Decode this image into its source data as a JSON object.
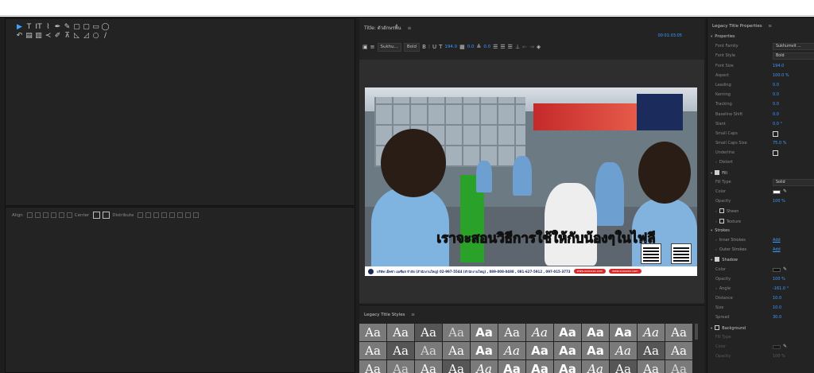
{
  "tools": [
    {
      "icon": "selection-tool-icon",
      "glyph": "▶",
      "selected": true
    },
    {
      "icon": "type-tool-icon",
      "glyph": "T"
    },
    {
      "icon": "vertical-type-tool-icon",
      "glyph": "IT"
    },
    {
      "icon": "path-type-tool-icon",
      "glyph": "⌇"
    },
    {
      "icon": "pen-tool-icon",
      "glyph": "✒"
    },
    {
      "icon": "add-anchor-point-tool-icon",
      "glyph": "✎"
    },
    {
      "icon": "rectangle-tool-icon",
      "glyph": "▢"
    },
    {
      "icon": "rounded-rectangle-tool-icon",
      "glyph": "▢"
    },
    {
      "icon": "clipped-corner-rectangle-tool-icon",
      "glyph": "▭"
    },
    {
      "icon": "ellipse-tool-icon",
      "glyph": "◯"
    },
    {
      "icon": "rotation-tool-icon",
      "glyph": "↶"
    },
    {
      "icon": "area-type-tool-icon",
      "glyph": "▤"
    },
    {
      "icon": "vertical-area-type-tool-icon",
      "glyph": "▥"
    },
    {
      "icon": "vertical-path-type-tool-icon",
      "glyph": "≺"
    },
    {
      "icon": "delete-anchor-point-tool-icon",
      "glyph": "✐"
    },
    {
      "icon": "convert-anchor-point-tool-icon",
      "glyph": "⊼"
    },
    {
      "icon": "wedge-tool-icon",
      "glyph": "◺"
    },
    {
      "icon": "arc-tool-icon",
      "glyph": "◿"
    },
    {
      "icon": "ellipse-tool-2-icon",
      "glyph": "○"
    },
    {
      "icon": "line-tool-icon",
      "glyph": "/"
    }
  ],
  "actions": {
    "align": "Align",
    "center": "Center",
    "distribute": "Distribute"
  },
  "title_panel": {
    "title": "Title: ตัวอักษรพื้น",
    "menu": "≡"
  },
  "format_bar": {
    "font_family": "Sukhu...",
    "font_style": "Bold",
    "font_size": "194.0",
    "kerning": "0.0",
    "leading": "0.0",
    "timecode": "00:01:03:05"
  },
  "video": {
    "subtitle": "เราจะสอนวิธีการใช้ให้กับน้องๆในไฟลี",
    "info_bar": "บริษัท เอ็คซ่า เอเซียส จำกัด (สำนักงานใหญ่) 02-997-5544 (สำนักงานใหญ่) , 089-008-0488 , 081-627-5912 , 097-015-3773",
    "badges": [
      "www.xxxxxxx.com",
      "www.xxxxxxx.com"
    ]
  },
  "styles_panel": {
    "title": "Legacy Title Styles",
    "menu": "≡",
    "sample": "Aa"
  },
  "properties_panel": {
    "title": "Legacy Title Properties",
    "menu": "≡",
    "rows": [
      {
        "kind": "section",
        "label": "Properties",
        "expander": "▾"
      },
      {
        "kind": "select",
        "label": "Font Family",
        "value": "Sukhumvit ..."
      },
      {
        "kind": "select",
        "label": "Font Style",
        "value": "Bold"
      },
      {
        "kind": "value",
        "label": "Font Size",
        "value": "194.0"
      },
      {
        "kind": "value",
        "label": "Aspect",
        "value": "100.0 %"
      },
      {
        "kind": "value",
        "label": "Leading",
        "value": "0.0"
      },
      {
        "kind": "value",
        "label": "Kerning",
        "value": "0.0"
      },
      {
        "kind": "value",
        "label": "Tracking",
        "value": "0.0"
      },
      {
        "kind": "value",
        "label": "Baseline Shift",
        "value": "0.0"
      },
      {
        "kind": "value",
        "label": "Slant",
        "value": "0.0 °"
      },
      {
        "kind": "check",
        "label": "Small Caps"
      },
      {
        "kind": "value",
        "label": "Small Caps Size",
        "value": "75.0 %"
      },
      {
        "kind": "check",
        "label": "Underline"
      },
      {
        "kind": "sub",
        "label": "Distort",
        "expander": "›"
      },
      {
        "kind": "section-check",
        "label": "Fill",
        "expander": "▾",
        "checked": true
      },
      {
        "kind": "select",
        "label": "Fill Type",
        "value": "Solid"
      },
      {
        "kind": "color",
        "label": "Color",
        "color": "#f4f4f4"
      },
      {
        "kind": "value",
        "label": "Opacity",
        "value": "100 %"
      },
      {
        "kind": "sub-check",
        "label": "Sheen",
        "expander": "›"
      },
      {
        "kind": "sub-check",
        "label": "Texture",
        "expander": "›"
      },
      {
        "kind": "section",
        "label": "Strokes",
        "expander": "▾"
      },
      {
        "kind": "link",
        "label": "Inner Strokes",
        "expander": "›",
        "value": "Add"
      },
      {
        "kind": "link",
        "label": "Outer Strokes",
        "expander": "›",
        "value": "Add"
      },
      {
        "kind": "section-check",
        "label": "Shadow",
        "expander": "▾",
        "checked": true
      },
      {
        "kind": "color",
        "label": "Color",
        "color": "#111111"
      },
      {
        "kind": "value",
        "label": "Opacity",
        "value": "100 %"
      },
      {
        "kind": "value",
        "label": "Angle",
        "value": "-161.0 °",
        "expander": "›"
      },
      {
        "kind": "value",
        "label": "Distance",
        "value": "10.0"
      },
      {
        "kind": "value",
        "label": "Size",
        "value": "10.0"
      },
      {
        "kind": "value",
        "label": "Spread",
        "value": "30.0"
      },
      {
        "kind": "section-check",
        "label": "Background",
        "expander": "▾",
        "checked": false
      },
      {
        "kind": "value",
        "label": "Fill Type",
        "value": "",
        "dim": true
      },
      {
        "kind": "color",
        "label": "Color",
        "color": "#111111",
        "dim": true
      },
      {
        "kind": "value",
        "label": "Opacity",
        "value": "100 %",
        "dim": true
      }
    ]
  }
}
